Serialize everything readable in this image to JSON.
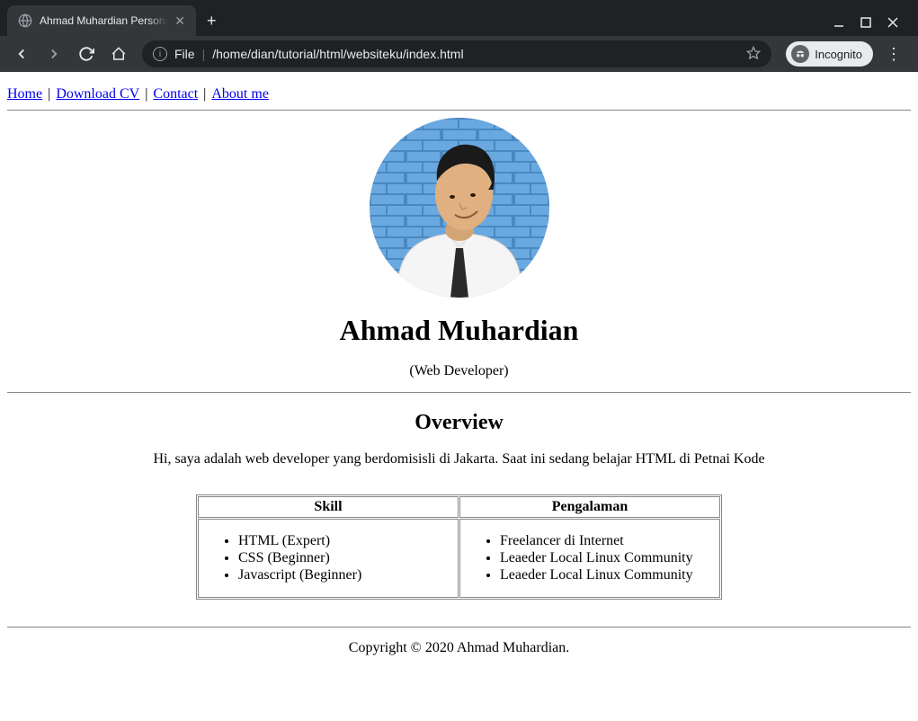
{
  "browser": {
    "tab_title": "Ahmad Muhardian Personal W",
    "url_scheme": "File",
    "url_path": "/home/dian/tutorial/html/websiteku/index.html",
    "incognito_label": "Incognito"
  },
  "nav": {
    "links": [
      "Home",
      "Download CV",
      "Contact",
      "About me"
    ],
    "separator": " | "
  },
  "profile": {
    "name": "Ahmad Muhardian",
    "role": "(Web Developer)"
  },
  "overview": {
    "heading": "Overview",
    "text": "Hi, saya adalah web developer yang berdomisisli di Jakarta. Saat ini sedang belajar HTML di Petnai Kode"
  },
  "table": {
    "headers": [
      "Skill",
      "Pengalaman"
    ],
    "skills": [
      "HTML (Expert)",
      "CSS (Beginner)",
      "Javascript (Beginner)"
    ],
    "experience": [
      "Freelancer di Internet",
      "Leaeder Local Linux Community",
      "Leaeder Local Linux Community"
    ]
  },
  "footer": {
    "copyright": "Copyright © 2020 Ahmad Muhardian."
  }
}
